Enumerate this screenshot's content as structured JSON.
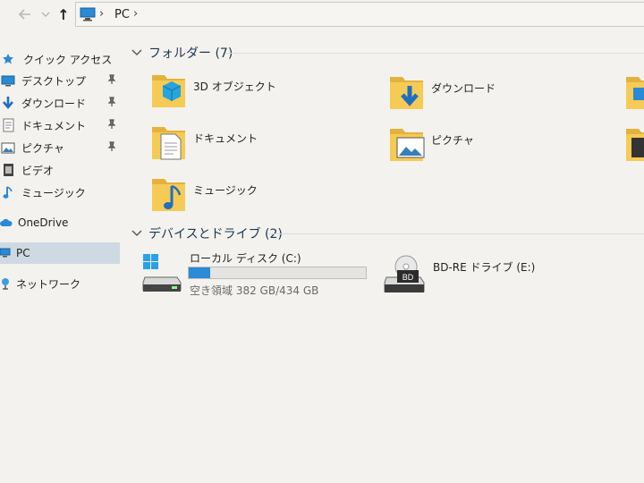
{
  "nav": {
    "up_glyph": "↑"
  },
  "address": {
    "crumb": "PC",
    "sep": "›"
  },
  "sidebar": {
    "quick_access": "クイック アクセス",
    "items": [
      {
        "label": "デスクトップ"
      },
      {
        "label": "ダウンロード"
      },
      {
        "label": "ドキュメント"
      },
      {
        "label": "ピクチャ"
      },
      {
        "label": "ビデオ"
      },
      {
        "label": "ミュージック"
      }
    ],
    "onedrive": "OneDrive",
    "pc": "PC",
    "network": "ネットワーク"
  },
  "folders_group": {
    "title": "フォルダー (7)"
  },
  "folders": [
    {
      "label": "3D オブジェクト",
      "icon": "3d-objects-icon"
    },
    {
      "label": "ダウンロード",
      "icon": "downloads-icon"
    },
    {
      "label": "ドキュメント",
      "icon": "documents-icon"
    },
    {
      "label": "ピクチャ",
      "icon": "pictures-icon"
    },
    {
      "label": "ミュージック",
      "icon": "music-icon"
    }
  ],
  "drives_group": {
    "title": "デバイスとドライブ (2)"
  },
  "drives": [
    {
      "label": "ローカル ディスク (C:)",
      "free_text": "空き領域 382 GB/434 GB",
      "used_fraction": 0.12
    },
    {
      "label": "BD-RE ドライブ (E:)",
      "badge": "BD"
    }
  ],
  "colors": {
    "accent": "#2a8ad6",
    "folder": "#f2c84b",
    "selected": "#cfd9e3"
  }
}
